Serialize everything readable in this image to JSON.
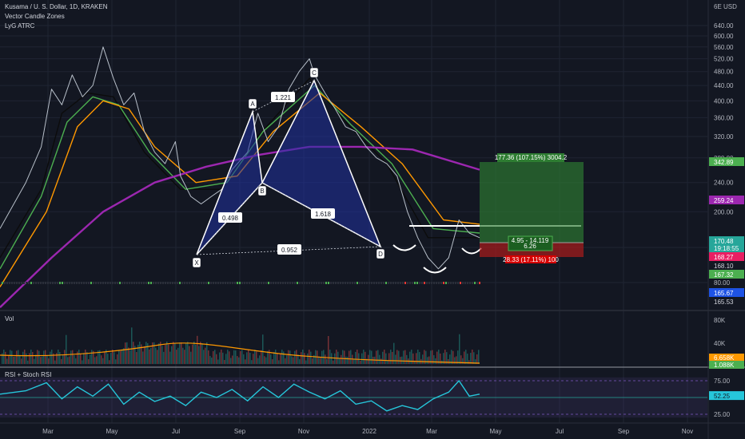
{
  "header": {
    "symbol_line": "Kusama / U. S. Dollar, 1D, KRAKEN",
    "indicator_1": "Vector Candle Zones",
    "indicator_2": "LyG ATRC"
  },
  "panels": {
    "volume_label": "Vol",
    "rsi_label": "RSI + Stoch RSI"
  },
  "chart_data": {
    "type": "line",
    "symbol": "Kusama / U. S. Dollar",
    "timeframe": "1D",
    "exchange": "KRAKEN",
    "x_labels": [
      "Mar",
      "May",
      "Jul",
      "Sep",
      "Nov",
      "2022",
      "Mar",
      "May",
      "Jul",
      "Sep",
      "Nov"
    ],
    "price_axis": {
      "scale": "log",
      "ticks": [
        "640.00",
        "600.00",
        "560.00",
        "520.00",
        "480.00",
        "440.00",
        "400.00",
        "360.00",
        "320.00",
        "280.00",
        "240.00",
        "200.00",
        "160.00",
        "80.00"
      ],
      "top_label": "6E USD",
      "price_tags": [
        {
          "text": "342.89",
          "color": "#4caf50"
        },
        {
          "text": "259.24",
          "color": "#9c27b0"
        },
        {
          "text": "170.48",
          "color": "#26a69a"
        },
        {
          "text": "19:18:55",
          "color": "#26a69a"
        },
        {
          "text": "168.27",
          "color": "#e91e63"
        },
        {
          "text": "168.10",
          "color": "#131722"
        },
        {
          "text": "167.32",
          "color": "#4caf50"
        },
        {
          "text": "165.67",
          "color": "#1e53e5"
        },
        {
          "text": "165.53",
          "color": "#131722"
        }
      ]
    },
    "price_series": [
      {
        "name": "KSM/USD close",
        "color": "#b7bfc9",
        "values": [
          [
            0,
            180
          ],
          [
            10,
            240
          ],
          [
            16,
            300
          ],
          [
            20,
            430
          ],
          [
            24,
            390
          ],
          [
            28,
            470
          ],
          [
            32,
            410
          ],
          [
            36,
            440
          ],
          [
            40,
            560
          ],
          [
            44,
            460
          ],
          [
            48,
            390
          ],
          [
            52,
            420
          ],
          [
            56,
            330
          ],
          [
            60,
            290
          ],
          [
            64,
            270
          ],
          [
            68,
            310
          ],
          [
            70,
            250
          ],
          [
            74,
            220
          ],
          [
            78,
            210
          ],
          [
            82,
            220
          ],
          [
            86,
            230
          ],
          [
            90,
            260
          ],
          [
            96,
            290
          ],
          [
            100,
            370
          ],
          [
            104,
            310
          ],
          [
            108,
            340
          ],
          [
            112,
            430
          ],
          [
            116,
            480
          ],
          [
            120,
            520
          ],
          [
            122,
            470
          ],
          [
            126,
            420
          ],
          [
            130,
            380
          ],
          [
            134,
            340
          ],
          [
            138,
            330
          ],
          [
            142,
            300
          ],
          [
            146,
            280
          ],
          [
            150,
            270
          ],
          [
            154,
            250
          ],
          [
            158,
            200
          ],
          [
            162,
            170
          ],
          [
            166,
            150
          ],
          [
            170,
            140
          ],
          [
            174,
            150
          ],
          [
            178,
            190
          ],
          [
            182,
            175
          ],
          [
            186,
            170
          ]
        ]
      },
      {
        "name": "EMA black",
        "color": "#0c0c0c",
        "values": [
          [
            0,
            150
          ],
          [
            16,
            230
          ],
          [
            24,
            370
          ],
          [
            34,
            420
          ],
          [
            44,
            410
          ],
          [
            56,
            290
          ],
          [
            70,
            230
          ],
          [
            86,
            230
          ],
          [
            100,
            320
          ],
          [
            120,
            460
          ],
          [
            134,
            350
          ],
          [
            150,
            270
          ],
          [
            166,
            170
          ],
          [
            186,
            170
          ]
        ]
      },
      {
        "name": "EMA green",
        "color": "#4caf50",
        "values": [
          [
            0,
            140
          ],
          [
            16,
            220
          ],
          [
            26,
            350
          ],
          [
            36,
            410
          ],
          [
            46,
            390
          ],
          [
            58,
            290
          ],
          [
            72,
            230
          ],
          [
            88,
            240
          ],
          [
            102,
            330
          ],
          [
            122,
            440
          ],
          [
            136,
            345
          ],
          [
            152,
            270
          ],
          [
            168,
            180
          ],
          [
            186,
            175
          ]
        ]
      },
      {
        "name": "EMA orange",
        "color": "#ff9800",
        "values": [
          [
            0,
            125
          ],
          [
            18,
            200
          ],
          [
            30,
            340
          ],
          [
            40,
            400
          ],
          [
            50,
            380
          ],
          [
            60,
            300
          ],
          [
            76,
            240
          ],
          [
            92,
            250
          ],
          [
            106,
            330
          ],
          [
            124,
            420
          ],
          [
            140,
            340
          ],
          [
            156,
            270
          ],
          [
            172,
            190
          ],
          [
            186,
            185
          ]
        ]
      },
      {
        "name": "MA purple",
        "color": "#9c27b0",
        "values": [
          [
            0,
            110
          ],
          [
            20,
            150
          ],
          [
            40,
            200
          ],
          [
            60,
            240
          ],
          [
            80,
            265
          ],
          [
            100,
            285
          ],
          [
            120,
            300
          ],
          [
            140,
            300
          ],
          [
            160,
            295
          ],
          [
            186,
            260
          ]
        ]
      }
    ],
    "harmonic_pattern": {
      "type": "crab",
      "points": [
        {
          "label": "X",
          "t": 76,
          "price": 158
        },
        {
          "label": "A",
          "t": 98,
          "price": 470
        },
        {
          "label": "B",
          "t": 102,
          "price": 292
        },
        {
          "label": "C",
          "t": 122,
          "price": 540
        },
        {
          "label": "D",
          "t": 147,
          "price": 172
        }
      ],
      "ratios": [
        "0.498",
        "1.221",
        "1.618",
        "0.952"
      ]
    },
    "position": {
      "target_label": "177.36 (107.15%) 3004.2",
      "entry_label_1": "4.95 - 14.119",
      "entry_label_2": "6.26",
      "stop_label": "28.33 (17.11%) 100"
    },
    "volume_axis": {
      "ticks": [
        "80K",
        "40K"
      ],
      "tags": [
        {
          "text": "6.658K",
          "color": "#ff9800"
        },
        {
          "text": "1.088K",
          "color": "#4caf50"
        }
      ]
    },
    "rsi_axis": {
      "ticks": [
        "75.00",
        "25.00"
      ],
      "tags": [
        {
          "text": "52.25",
          "color": "#26c6da"
        }
      ]
    },
    "rsi_series": {
      "name": "RSI",
      "color": "#26c6da",
      "values": [
        [
          0,
          55
        ],
        [
          10,
          60
        ],
        [
          18,
          72
        ],
        [
          24,
          48
        ],
        [
          30,
          66
        ],
        [
          36,
          52
        ],
        [
          42,
          70
        ],
        [
          48,
          40
        ],
        [
          54,
          58
        ],
        [
          60,
          44
        ],
        [
          66,
          52
        ],
        [
          72,
          38
        ],
        [
          78,
          58
        ],
        [
          84,
          50
        ],
        [
          90,
          62
        ],
        [
          96,
          45
        ],
        [
          102,
          66
        ],
        [
          108,
          50
        ],
        [
          114,
          70
        ],
        [
          120,
          58
        ],
        [
          126,
          48
        ],
        [
          132,
          60
        ],
        [
          138,
          40
        ],
        [
          144,
          45
        ],
        [
          150,
          30
        ],
        [
          156,
          38
        ],
        [
          162,
          32
        ],
        [
          168,
          48
        ],
        [
          174,
          58
        ],
        [
          178,
          75
        ],
        [
          182,
          52
        ],
        [
          186,
          55
        ]
      ]
    }
  }
}
